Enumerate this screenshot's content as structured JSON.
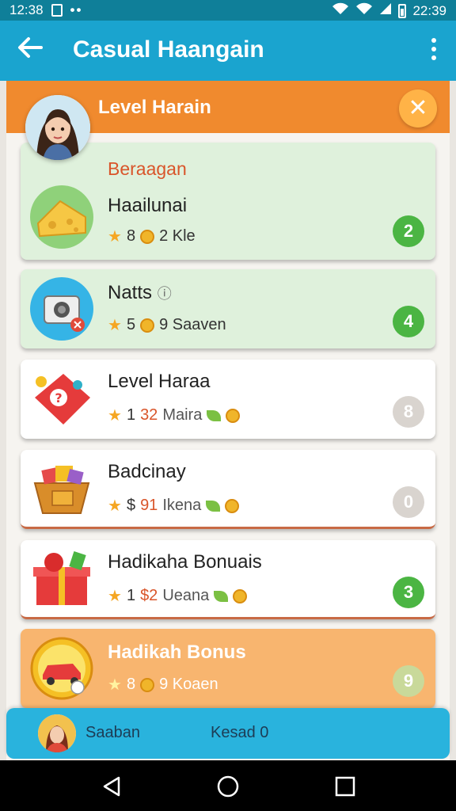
{
  "status": {
    "time_left": "12:38",
    "time_right": "22:39"
  },
  "app_bar": {
    "title": "Casual Haangain"
  },
  "panel": {
    "title": "Level Harain"
  },
  "items": [
    {
      "subtitle": "Beraagan",
      "name": "Haailunai",
      "meta_a": "8",
      "meta_b": "2 Kle",
      "badge": "2",
      "badge_color": "green"
    },
    {
      "name": "Natts",
      "meta_a": "5",
      "meta_b": "9 Saaven",
      "badge": "4",
      "badge_color": "green"
    },
    {
      "name": "Level Haraa",
      "meta_a": "1",
      "meta_b": "32",
      "meta_c": "Maira",
      "badge": "8",
      "badge_color": "grey"
    },
    {
      "name": "Badcinay",
      "meta_a": "$",
      "meta_b": "91",
      "meta_c": "Ikena",
      "badge": "0",
      "badge_color": "grey"
    },
    {
      "name": "Hadikaha Bonuais",
      "meta_a": "1",
      "meta_b": "$2",
      "meta_c": "Ueana",
      "badge": "3",
      "badge_color": "green"
    },
    {
      "name": "Hadikah Bonus",
      "meta_a": "8",
      "meta_b": "9 Koaen",
      "badge": "9",
      "badge_color": "green"
    }
  ],
  "bottom_bar": {
    "label_left": "Saaban",
    "label_right": "Kesad 0"
  },
  "colors": {
    "accent": "#1aa4cf",
    "header": "#f08a2e",
    "green_badge": "#4bb543"
  },
  "icons": [
    "back-arrow-icon",
    "more-vert-icon",
    "close-icon",
    "star-icon",
    "coin-icon",
    "leaf-icon",
    "nav-back-icon",
    "nav-home-icon",
    "nav-recents-icon"
  ]
}
